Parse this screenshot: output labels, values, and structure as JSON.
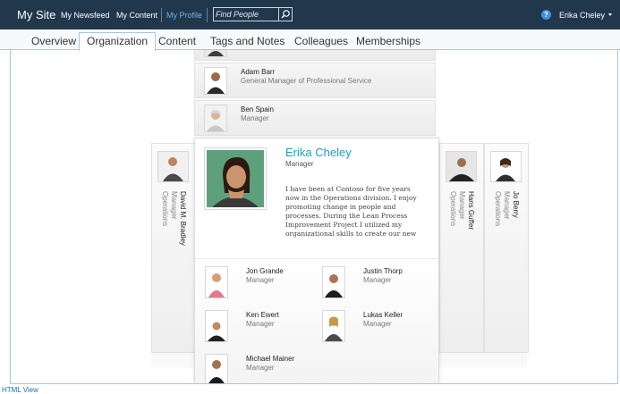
{
  "topbar": {
    "site_title": "My Site",
    "nav": [
      "My Newsfeed",
      "My Content",
      "My Profile"
    ],
    "search_placeholder": "Find People",
    "help_label": "?",
    "user_name": "Erika Cheley"
  },
  "tabs": [
    "Overview",
    "Organization",
    "Content",
    "Tags and Notes",
    "Colleagues",
    "Memberships"
  ],
  "managers": [
    {
      "name": "Adam Barr",
      "title": "General Manager of Professional Service"
    },
    {
      "name": "Ben Spain",
      "title": "Manager"
    }
  ],
  "left_peers": [
    {
      "name": "David M. Bradley",
      "title": "Manager",
      "dept": "Operations"
    }
  ],
  "right_peers": [
    {
      "name": "Hans Guffer",
      "title": "Manager",
      "dept": "Operations"
    },
    {
      "name": "Jo Berry",
      "title": "Manager",
      "dept": "Operations"
    }
  ],
  "profile": {
    "name": "Erika Cheley",
    "title": "Manager",
    "bio_lines": [
      "I have been at Contoso for five years",
      "now in the Operations division. I enjoy",
      "promoting change in people and",
      "processes. During the Lean Process",
      "Improvement Project I utilized my",
      "organizational skills to create our new"
    ]
  },
  "reports": [
    {
      "name": "Jon Grande",
      "title": "Manager"
    },
    {
      "name": "Justin Thorp",
      "title": "Manager"
    },
    {
      "name": "Ken Ewert",
      "title": "Manager"
    },
    {
      "name": "Lukas Keller",
      "title": "Manager"
    },
    {
      "name": "Michael Mainer",
      "title": "Manager"
    }
  ],
  "footer": {
    "html_view": "HTML View"
  },
  "colors": {
    "topbar": "#21374c",
    "accent_name": "#1da0c7",
    "tab_border": "#a4c8e5",
    "link": "#1a6fb0"
  },
  "icons": [
    "search-icon",
    "help-icon",
    "chevron-down-icon",
    "person-photo-icon"
  ]
}
